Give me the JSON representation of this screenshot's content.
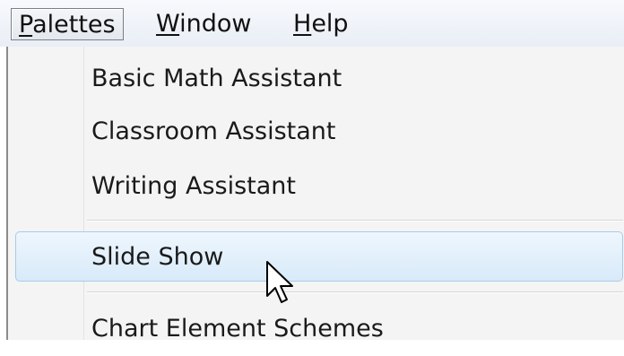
{
  "menubar": {
    "items": [
      {
        "mnemonic": "P",
        "rest": "alettes",
        "active": true
      },
      {
        "mnemonic": "W",
        "rest": "indow",
        "active": false
      },
      {
        "mnemonic": "H",
        "rest": "elp",
        "active": false
      }
    ]
  },
  "menu": {
    "items": [
      {
        "label": "Basic Math Assistant"
      },
      {
        "label": "Classroom Assistant"
      },
      {
        "label": "Writing Assistant"
      },
      {
        "label": "Slide Show",
        "highlighted": true
      },
      {
        "label": "Chart Element Schemes"
      }
    ]
  },
  "cursor": {
    "icon": "arrow-cursor-icon"
  }
}
